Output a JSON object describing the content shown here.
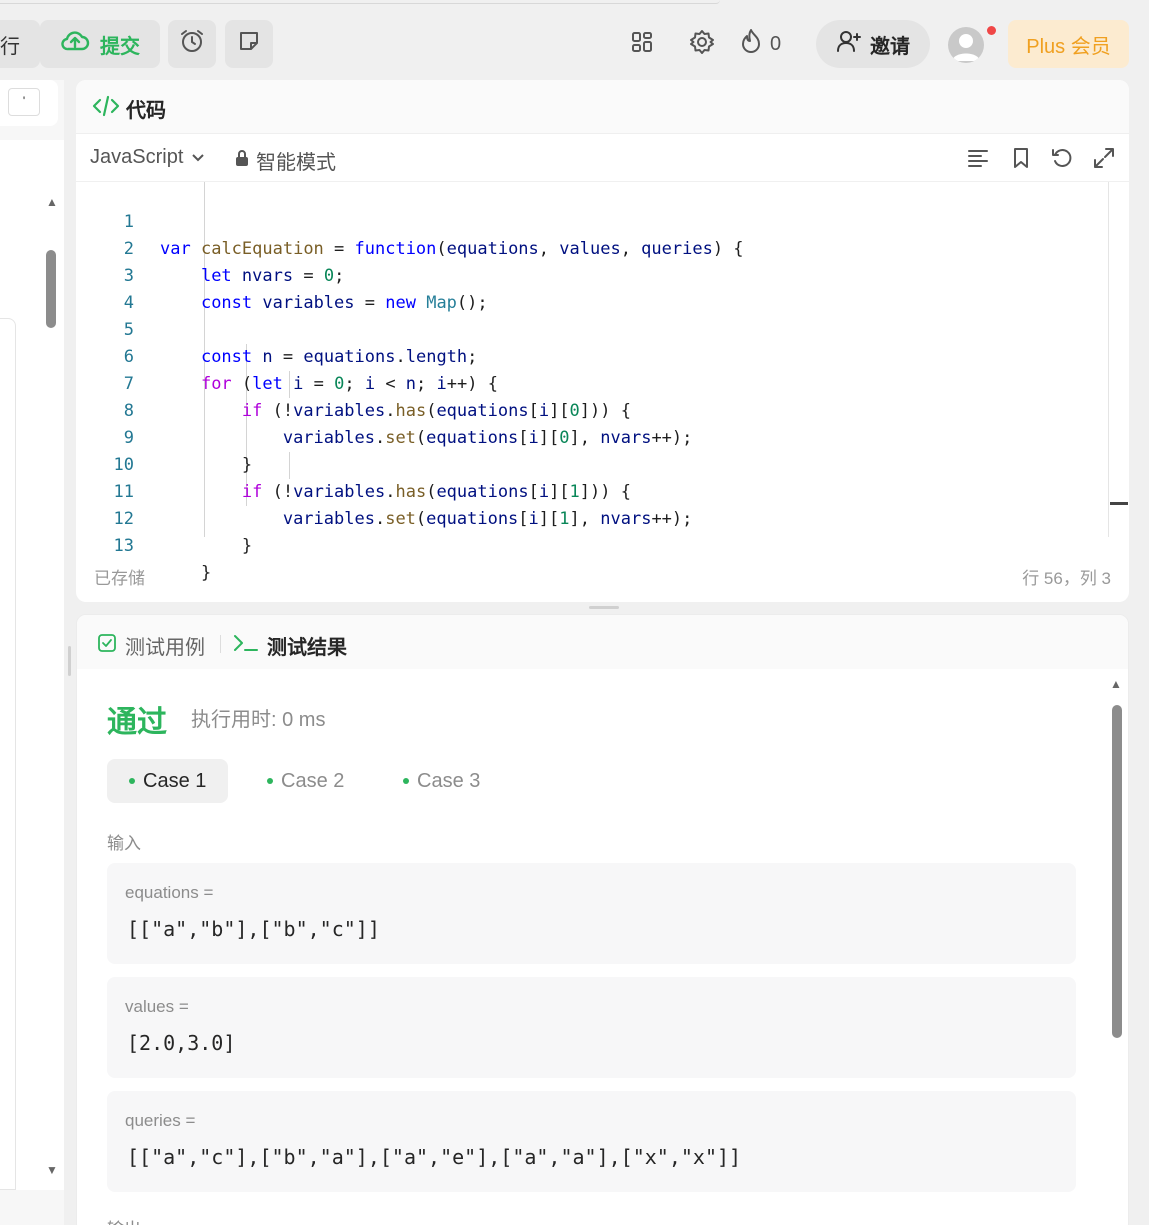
{
  "topbar": {
    "run_label": "行",
    "submit_label": "提交",
    "fire_count": "0",
    "invite_label": "邀请",
    "plus_label": "Plus 会员",
    "icons": [
      "cloud-upload-icon",
      "alarm-clock-icon",
      "note-icon",
      "layout-grid-icon",
      "gear-icon",
      "fire-icon",
      "add-user-icon",
      "avatar"
    ]
  },
  "left_panel": {
    "key_label": "'"
  },
  "code_panel": {
    "title": "代码",
    "language": "JavaScript",
    "mode": "智能模式",
    "status": "已存储",
    "position": "行 56，列 3",
    "lines": [
      {
        "n": "1",
        "code": "var calcEquation = function(equations, values, queries) {"
      },
      {
        "n": "2",
        "code": "    let nvars = 0;"
      },
      {
        "n": "3",
        "code": "    const variables = new Map();"
      },
      {
        "n": "4",
        "code": ""
      },
      {
        "n": "5",
        "code": "    const n = equations.length;"
      },
      {
        "n": "6",
        "code": "    for (let i = 0; i < n; i++) {"
      },
      {
        "n": "7",
        "code": "        if (!variables.has(equations[i][0])) {"
      },
      {
        "n": "8",
        "code": "            variables.set(equations[i][0], nvars++);"
      },
      {
        "n": "9",
        "code": "        }"
      },
      {
        "n": "10",
        "code": "        if (!variables.has(equations[i][1])) {"
      },
      {
        "n": "11",
        "code": "            variables.set(equations[i][1], nvars++);"
      },
      {
        "n": "12",
        "code": "        }"
      },
      {
        "n": "13",
        "code": "    }"
      }
    ]
  },
  "result_panel": {
    "tab_testcase": "测试用例",
    "tab_result": "测试结果",
    "status": "通过",
    "runtime": "执行用时: 0 ms",
    "cases": [
      "Case 1",
      "Case 2",
      "Case 3"
    ],
    "active_case": "Case 1",
    "input_label": "输入",
    "inputs": [
      {
        "name": "equations =",
        "value": "[[\"a\",\"b\"],[\"b\",\"c\"]]"
      },
      {
        "name": "values =",
        "value": "[2.0,3.0]"
      },
      {
        "name": "queries =",
        "value": "[[\"a\",\"c\"],[\"b\",\"a\"],[\"a\",\"e\"],[\"a\",\"a\"],[\"x\",\"x\"]]"
      }
    ],
    "output_label": "输出"
  },
  "colors": {
    "accent_green": "#2db55d",
    "plus_orange": "#f0a020",
    "notification_red": "#f04747"
  }
}
